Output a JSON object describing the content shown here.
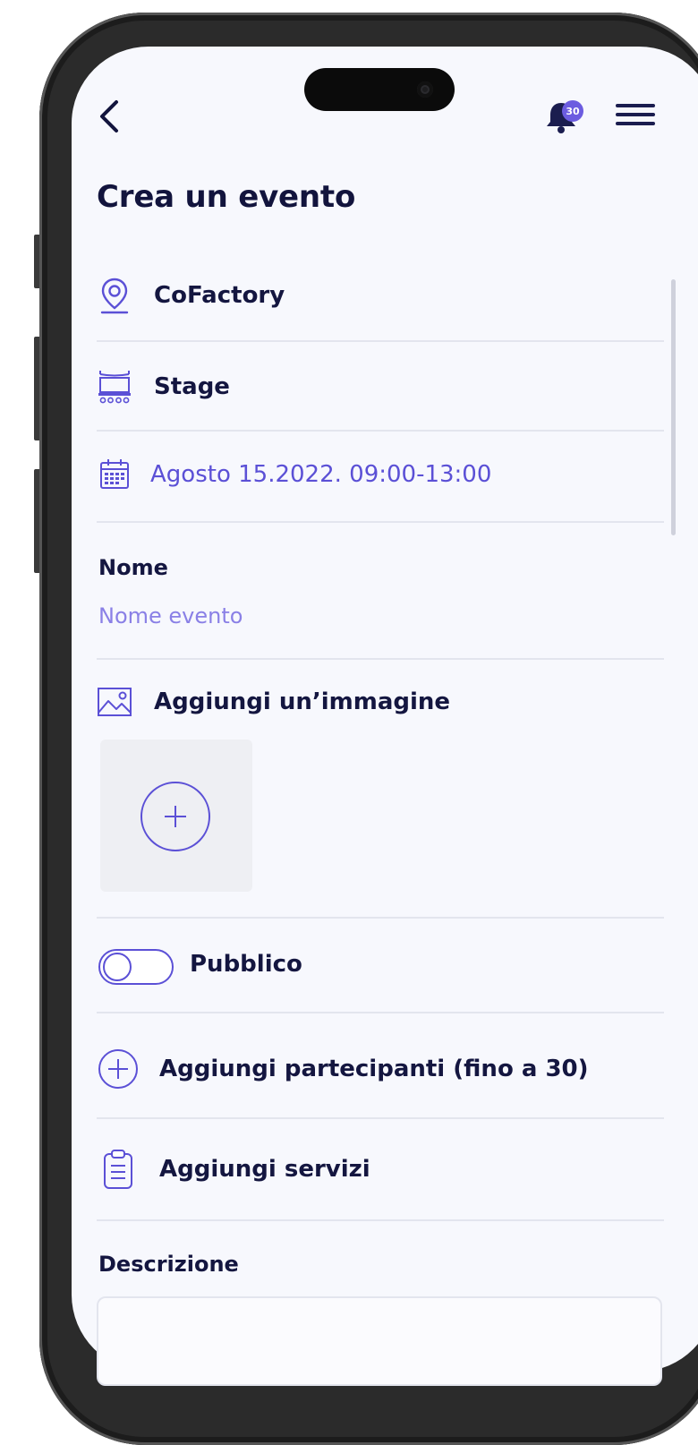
{
  "header": {
    "back_icon": "chevron-left-icon",
    "notification_count": "30",
    "menu_icon": "hamburger-menu-icon"
  },
  "page_title": "Crea un evento",
  "location": {
    "icon": "map-pin-icon",
    "label": "CoFactory"
  },
  "room": {
    "icon": "stage-icon",
    "label": "Stage"
  },
  "datetime": {
    "icon": "calendar-icon",
    "label": "Agosto 15.2022. 09:00-13:00"
  },
  "name_field": {
    "label": "Nome",
    "placeholder": "Nome evento",
    "value": ""
  },
  "image_section": {
    "icon": "image-icon",
    "label": "Aggiungi un’immagine",
    "add_icon": "plus-circle-icon"
  },
  "public_toggle": {
    "label": "Pubblico",
    "on": false
  },
  "participants": {
    "icon": "plus-circle-icon",
    "label": "Aggiungi partecipanti (fino a 30)"
  },
  "services": {
    "icon": "clipboard-icon",
    "label": "Aggiungi servizi"
  },
  "description": {
    "label": "Descrizione",
    "value": ""
  },
  "colors": {
    "accent": "#5b50d6",
    "text_dark": "#141640",
    "divider": "#e3e5ee",
    "badge": "#6c5ce0"
  }
}
